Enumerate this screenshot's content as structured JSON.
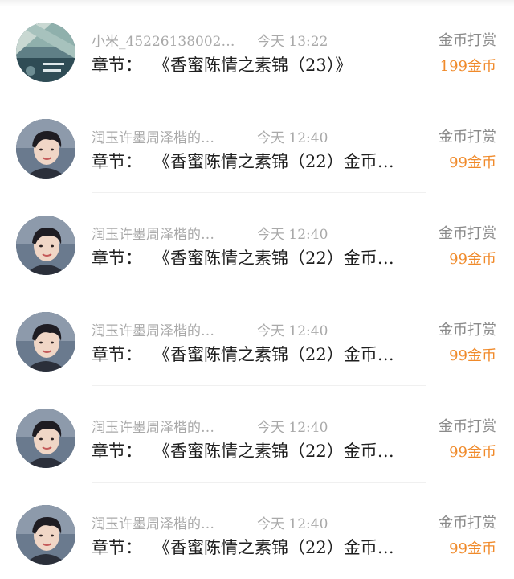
{
  "records": [
    {
      "avatar": "scenery-avatar",
      "username": "小米_45226138002…",
      "time": "今天 13:22",
      "chapter_prefix": "章节：",
      "chapter_title": "《香蜜陈情之素锦（23）》",
      "reward_type": "金币打赏",
      "amount": "199金币"
    },
    {
      "avatar": "portrait-avatar",
      "username": "润玉许墨周泽楷的…",
      "time": "今天 12:40",
      "chapter_prefix": "章节：",
      "chapter_title": "《香蜜陈情之素锦（22）金币…",
      "reward_type": "金币打赏",
      "amount": "99金币"
    },
    {
      "avatar": "portrait-avatar",
      "username": "润玉许墨周泽楷的…",
      "time": "今天 12:40",
      "chapter_prefix": "章节：",
      "chapter_title": "《香蜜陈情之素锦（22）金币…",
      "reward_type": "金币打赏",
      "amount": "99金币"
    },
    {
      "avatar": "portrait-avatar",
      "username": "润玉许墨周泽楷的…",
      "time": "今天 12:40",
      "chapter_prefix": "章节：",
      "chapter_title": "《香蜜陈情之素锦（22）金币…",
      "reward_type": "金币打赏",
      "amount": "99金币"
    },
    {
      "avatar": "portrait-avatar",
      "username": "润玉许墨周泽楷的…",
      "time": "今天 12:40",
      "chapter_prefix": "章节：",
      "chapter_title": "《香蜜陈情之素锦（22）金币…",
      "reward_type": "金币打赏",
      "amount": "99金币"
    },
    {
      "avatar": "portrait-avatar",
      "username": "润玉许墨周泽楷的…",
      "time": "今天 12:40",
      "chapter_prefix": "章节：",
      "chapter_title": "《香蜜陈情之素锦（22）金币…",
      "reward_type": "金币打赏",
      "amount": "99金币"
    }
  ],
  "colors": {
    "amount": "#f08a2a",
    "meta": "#a9a9a9",
    "chapter": "#1e1e1e",
    "reward_type": "#8a8a8a"
  }
}
